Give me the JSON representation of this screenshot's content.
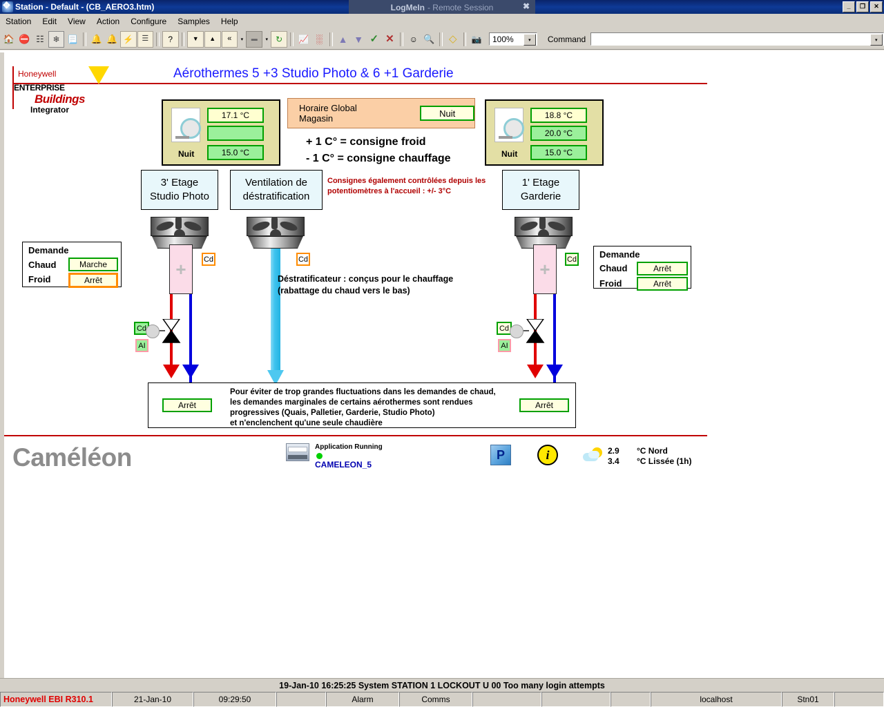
{
  "window": {
    "title": "Station - Default - (CB_AERO3.htm)",
    "icon": "station-icon",
    "minimize": "_",
    "restore": "❐",
    "close": "✕"
  },
  "logmein": {
    "brand": "LogMeIn",
    "suffix": " - Remote Session",
    "close": "✖"
  },
  "menubar": {
    "items": [
      {
        "label": "Station"
      },
      {
        "label": "Edit"
      },
      {
        "label": "View"
      },
      {
        "label": "Action"
      },
      {
        "label": "Configure"
      },
      {
        "label": "Samples"
      },
      {
        "label": "Help"
      }
    ]
  },
  "toolbar": {
    "buttons": [
      {
        "name": "home-icon",
        "glyph": "🏠"
      },
      {
        "name": "stop-alarm-icon",
        "glyph": "⛔"
      },
      {
        "name": "system-tree-icon",
        "glyph": "☷"
      },
      {
        "name": "point-detail-icon",
        "glyph": "❄"
      },
      {
        "name": "trend-report-icon",
        "glyph": "📃"
      },
      {
        "name": "alarm-bell-icon",
        "glyph": "🔔"
      },
      {
        "name": "alarm-ack-icon",
        "glyph": "🔔"
      },
      {
        "name": "event-flash-icon",
        "glyph": "⚡"
      },
      {
        "name": "alarm-list-icon",
        "glyph": "☰"
      },
      {
        "name": "help-point-icon",
        "glyph": "?"
      },
      {
        "name": "page-down-icon",
        "glyph": "▼"
      },
      {
        "name": "page-up-icon",
        "glyph": "▲"
      },
      {
        "name": "page-back-icon",
        "glyph": "«"
      },
      {
        "name": "page-back-dropdown",
        "glyph": "▾"
      },
      {
        "name": "recent-pages-icon",
        "glyph": "▬"
      },
      {
        "name": "recent-pages-dropdown",
        "glyph": "▾"
      },
      {
        "name": "refresh-page-icon",
        "glyph": "↻"
      },
      {
        "name": "trend-chart-icon",
        "glyph": "📈"
      },
      {
        "name": "group-display-icon",
        "glyph": "░"
      },
      {
        "name": "raise-icon",
        "glyph": "▲"
      },
      {
        "name": "lower-icon",
        "glyph": "▼"
      },
      {
        "name": "accept-icon",
        "glyph": "✓"
      },
      {
        "name": "cancel-icon",
        "glyph": "✕"
      },
      {
        "name": "operator-icon",
        "glyph": "☺"
      },
      {
        "name": "find-icon",
        "glyph": "🔍"
      },
      {
        "name": "notes-icon",
        "glyph": "◇"
      },
      {
        "name": "camera-icon",
        "glyph": "📷"
      }
    ],
    "zoom_value": "100%",
    "zoom_arrow": "▾",
    "command_label": "Command",
    "command_value": "",
    "command_arrow": "▾"
  },
  "page": {
    "title": "Aérothermes 5 +3 Studio Photo & 6 +1 Garderie",
    "logo": {
      "brand": "Honeywell",
      "line1": "ENTERPRISE",
      "line2": "Buildings",
      "line3": "Integrator"
    },
    "left_panel": {
      "temp_current": "17.1 °C",
      "temp_setpoint": "",
      "mode_label": "Nuit",
      "mode_value": "15.0 °C"
    },
    "right_panel": {
      "temp_current": "18.8 °C",
      "temp_setpoint": "20.0 °C",
      "mode_label": "Nuit",
      "mode_value": "15.0 °C"
    },
    "horaire": {
      "label": "Horaire Global Magasin",
      "value": "Nuit"
    },
    "consigne": {
      "line1": "+ 1 C° = consigne froid",
      "line2": "- 1 C° = consigne chauffage"
    },
    "red_note": {
      "line1": "Consignes également contrôlées depuis les",
      "line2": "potentiomètres à l'accueil : +/- 3°C"
    },
    "zones": [
      {
        "line1": "3' Etage",
        "line2": "Studio Photo"
      },
      {
        "line1": "Ventilation de",
        "line2": "déstratification"
      },
      {
        "line1": "1' Etage",
        "line2": "Garderie"
      }
    ],
    "destrat_note": {
      "line1": "Déstratificateur : conçus pour le chauffage",
      "line2": "(rabattage du chaud vers le bas)"
    },
    "demande_left": {
      "title": "Demande",
      "chaud_label": "Chaud",
      "chaud_value": "Marche",
      "froid_label": "Froid",
      "froid_value": "Arrêt"
    },
    "demande_right": {
      "title": "Demande",
      "chaud_label": "Chaud",
      "chaud_value": "Arrêt",
      "froid_label": "Froid",
      "froid_value": "Arrêt"
    },
    "badges": {
      "cd_left": "Cd",
      "cd_mid": "Cd",
      "cd_right": "Cd",
      "cd_valve_left": "Cd",
      "ai_valve_left": "AI",
      "cd_valve_right": "Cd",
      "ai_valve_right": "AI"
    },
    "bottom_note": {
      "left_value": "Arrêt",
      "right_value": "Arrêt",
      "line1": "Pour éviter de trop grandes fluctuations dans les demandes de chaud,",
      "line2": "les demandes marginales de certains aérothermes sont rendues",
      "line3": "progressives (Quais, Palletier, Garderie, Studio Photo)",
      "line4": "et n'enclenchent qu'une seule chaudière"
    },
    "footer": {
      "brand": "Caméléon",
      "app_status": "Application Running",
      "controller": "CAMELEON_5",
      "p_button": "P",
      "info_button": "i",
      "weather_value1": "2.9",
      "weather_value2": "3.4",
      "weather_label1": "°C Nord",
      "weather_label2": "°C Lissée (1h)"
    }
  },
  "alarm_line": "19-Jan-10  16:25:25  System  STATION  1   LOCKOUT   U 00 Too many login attempts",
  "statusbar": {
    "brand": "Honeywell EBI R310.1",
    "date": "21-Jan-10",
    "time": "09:29:50",
    "blank1": "",
    "alarm": "Alarm",
    "comms": "Comms",
    "blank2": "",
    "blank3": "",
    "blank4": "",
    "host": "localhost",
    "station": "Stn01",
    "blank5": ""
  }
}
